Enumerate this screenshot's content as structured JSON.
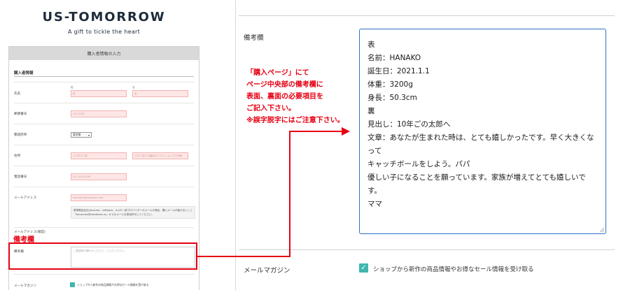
{
  "brand": {
    "title": "US-TOMORROW",
    "subtitle": "A gift to tickle the heart"
  },
  "form": {
    "header": "購入者情報の入力",
    "section_title": "購入者情報",
    "name_label": "氏名",
    "sei_hint": "姓",
    "mei_hint": "名",
    "sei_placeholder": "姓",
    "mei_placeholder": "名",
    "zip_label": "郵便番号",
    "zip_placeholder": "100-0001",
    "pref_label": "都道府県",
    "pref_value": "東京都",
    "address_label": "住所",
    "address1_placeholder": "〇〇市〇〇町",
    "address2_placeholder": "〇〇丁目〇〇番地〇〇マンション〇〇号室",
    "phone_label": "電話番号",
    "phone_placeholder": "012-345-6789",
    "email_label": "メールアドレス",
    "email_placeholder": "example@example.com",
    "email_note_1": "携帯電話会社(docomo、softbank、au)や一部プロバイダーのメールの場合、購入メールが届かないことがございます。",
    "email_note_2": "「tomorrow@hanakoos.xx」からのメールを受信許可してください。",
    "email_confirm_label": "メールアドレス(確認)",
    "remarks_label": "備考欄",
    "remarks_placeholder": "ご要望等お聞かせください。ご入力ください。",
    "magazine_label": "メールマガジン",
    "magazine_text": "ショップから新作の商品情報やお得なセール情報を受け取る"
  },
  "highlight": {
    "label": "備考欄"
  },
  "instructions": [
    "「購入ページ」にて",
    "ページ中央部の備考欄に",
    "表面、裏面の必要項目を",
    "ご記入下さい。",
    "※誤字脱字にはご注意下さい。"
  ],
  "remarks": {
    "label": "備考欄",
    "lines": [
      "表",
      "名前：HANAKO",
      "誕生日：2021.1.1",
      "体重：3200g",
      "身長：50.3cm",
      "",
      "裏",
      "見出し：10年ごの太郎へ",
      "文章：あなたが生まれた時は、とても嬉しかったです。早く大きくなって",
      "キャッチボールをしよう。パパ",
      "優しい子になることを願っています。家族が増えてとても嬉しいです。",
      "ママ"
    ]
  },
  "magazine": {
    "label": "メールマガジン",
    "text": "ショップから新作の商品情報やお得なセール情報を受け取る",
    "checked": true
  },
  "colors": {
    "accent_red": "#e60012",
    "textarea_border": "#2e72c8",
    "checkbox": "#3fb6ae",
    "input_error_bg": "#ffe6e6"
  }
}
